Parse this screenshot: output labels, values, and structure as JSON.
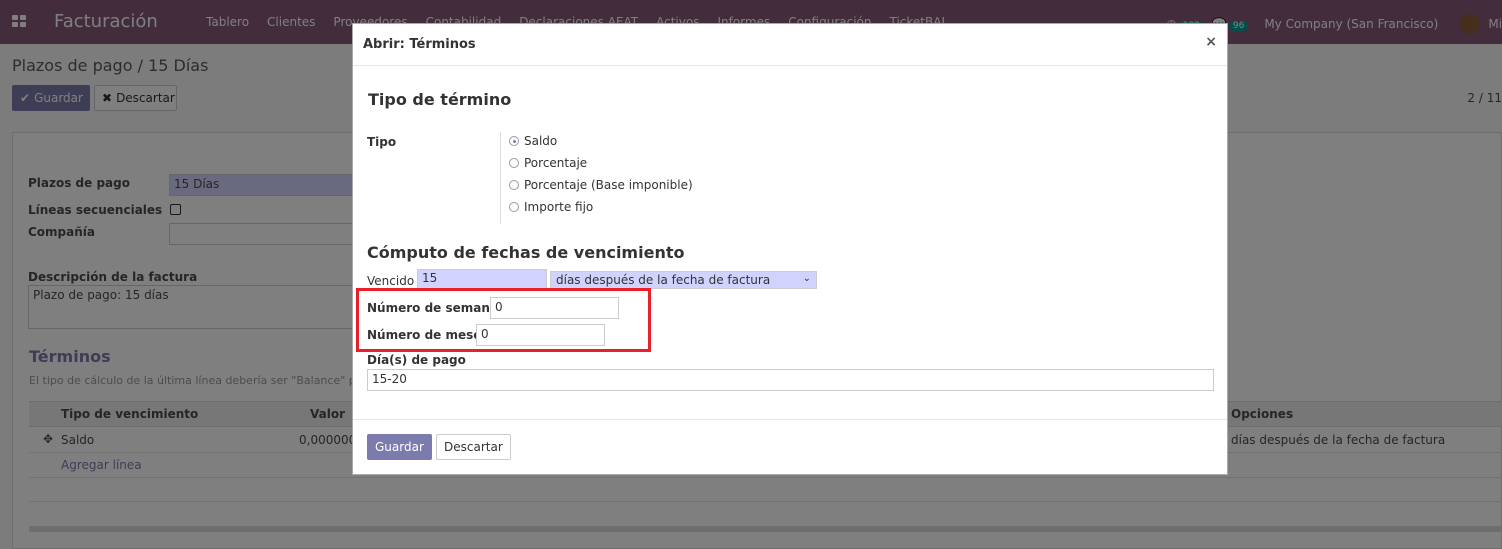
{
  "navbar": {
    "brand": "Facturación",
    "menu": [
      "Tablero",
      "Clientes",
      "Proveedores",
      "Contabilidad",
      "Declaraciones AEAT",
      "Activos",
      "Informes",
      "Configuración",
      "TicketBAI"
    ],
    "activity_count": "102",
    "messages_count": "96",
    "company": "My Company (San Francisco)",
    "user": "Mi"
  },
  "control_panel": {
    "breadcrumb": "Plazos de pago / 15 Días",
    "save_label": "Guardar",
    "discard_label": "Descartar",
    "pager": "2 / 11"
  },
  "background_form": {
    "payment_terms_label": "Plazos de pago",
    "payment_terms_value": "15 Días",
    "sequential_lines_label": "Líneas secuenciales",
    "company_label": "Compañía",
    "invoice_description_label": "Descripción de la factura",
    "invoice_description_value": "Plazo de pago: 15 días",
    "terms_heading": "Términos",
    "terms_hint": "El tipo de cálculo de la última línea debería ser \"Balance\" p",
    "table_headers": [
      "Tipo de vencimiento",
      "Valor",
      "Opciones"
    ],
    "row": {
      "type": "Saldo",
      "value": "0,000000",
      "options": "días después de la fecha de factura"
    },
    "add_line": "Agregar línea"
  },
  "modal": {
    "title": "Abrir: Términos",
    "section_type": "Tipo de término",
    "type_label": "Tipo",
    "type_options": [
      "Saldo",
      "Porcentaje",
      "Porcentaje (Base imponible)",
      "Importe fijo"
    ],
    "selected_type": "Saldo",
    "section_dates": "Cómputo de fechas de vencimiento",
    "due_label": "Vencido",
    "due_value": "15",
    "due_option": "días después de la fecha de factura",
    "weeks_label": "Número de semanas",
    "weeks_value": "0",
    "months_label": "Número de meses",
    "months_value": "0",
    "payment_days_label": "Día(s) de pago",
    "payment_days_value": "15-20",
    "save_label": "Guardar",
    "discard_label": "Descartar"
  },
  "colors": {
    "primary": "#875a7b",
    "button": "#7c7bad",
    "highlight": "#e8202a",
    "required_field": "#d2d2ff"
  }
}
